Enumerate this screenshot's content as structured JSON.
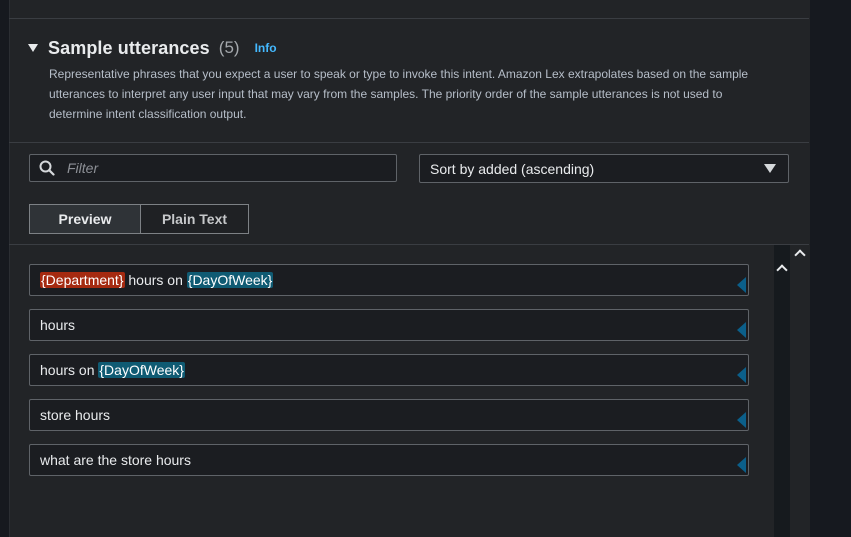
{
  "section": {
    "title": "Sample utterances",
    "count": "(5)",
    "info_label": "Info",
    "description": "Representative phrases that you expect a user to speak or type to invoke this intent. Amazon Lex extrapolates based on the sample utterances to interpret any user input that may vary from the samples. The priority order of the sample utterances is not used to determine intent classification output."
  },
  "filter": {
    "placeholder": "Filter",
    "value": ""
  },
  "sort": {
    "selected": "Sort by added (ascending)"
  },
  "tabs": [
    {
      "label": "Preview",
      "active": true
    },
    {
      "label": "Plain Text",
      "active": false
    }
  ],
  "utterances": [
    {
      "parts": [
        {
          "text": "{Department}",
          "slot": "red"
        },
        {
          "text": " hours on "
        },
        {
          "text": "{DayOfWeek}",
          "slot": "teal"
        }
      ]
    },
    {
      "parts": [
        {
          "text": "hours"
        }
      ]
    },
    {
      "parts": [
        {
          "text": "hours on "
        },
        {
          "text": "{DayOfWeek}",
          "slot": "teal"
        }
      ]
    },
    {
      "parts": [
        {
          "text": "store hours"
        }
      ]
    },
    {
      "parts": [
        {
          "text": "what are the store hours"
        }
      ]
    }
  ],
  "colors": {
    "info_link": "#44b9ff",
    "slot_department": "#a52a10",
    "slot_dayofweek": "#0f5b73",
    "resize_handle": "#0b5f8a"
  },
  "icons": {
    "collapse": "caret-down-icon",
    "search": "search-icon",
    "dropdown": "caret-down-icon",
    "scroll_up": "chevron-up-icon",
    "resize": "resize-handle-icon"
  }
}
